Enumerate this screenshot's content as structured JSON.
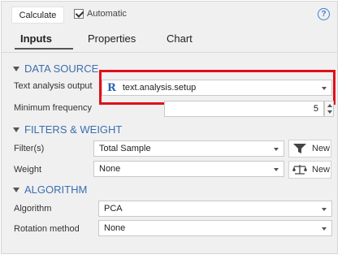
{
  "toolbar": {
    "calculate_label": "Calculate",
    "automatic_label": "Automatic",
    "automatic_checked": true,
    "help_icon": "?"
  },
  "tabs": [
    {
      "label": "Inputs",
      "active": true
    },
    {
      "label": "Properties",
      "active": false
    },
    {
      "label": "Chart",
      "active": false
    }
  ],
  "data_source": {
    "heading": "DATA SOURCE",
    "text_output_label": "Text analysis output",
    "text_output_icon": "R",
    "text_output_value": "text.analysis.setup",
    "min_freq_label": "Minimum frequency",
    "min_freq_value": "5"
  },
  "filters": {
    "heading": "FILTERS & WEIGHT",
    "filter_label": "Filter(s)",
    "filter_value": "Total Sample",
    "filter_new_label": "New",
    "weight_label": "Weight",
    "weight_value": "None",
    "weight_new_label": "New"
  },
  "algorithm": {
    "heading": "ALGORITHM",
    "algorithm_label": "Algorithm",
    "algorithm_value": "PCA",
    "rotation_label": "Rotation method",
    "rotation_value": "None"
  },
  "colors": {
    "section_heading": "#3b6fb0",
    "highlight_border": "#e0101a",
    "help_icon": "#3b7fd0"
  }
}
